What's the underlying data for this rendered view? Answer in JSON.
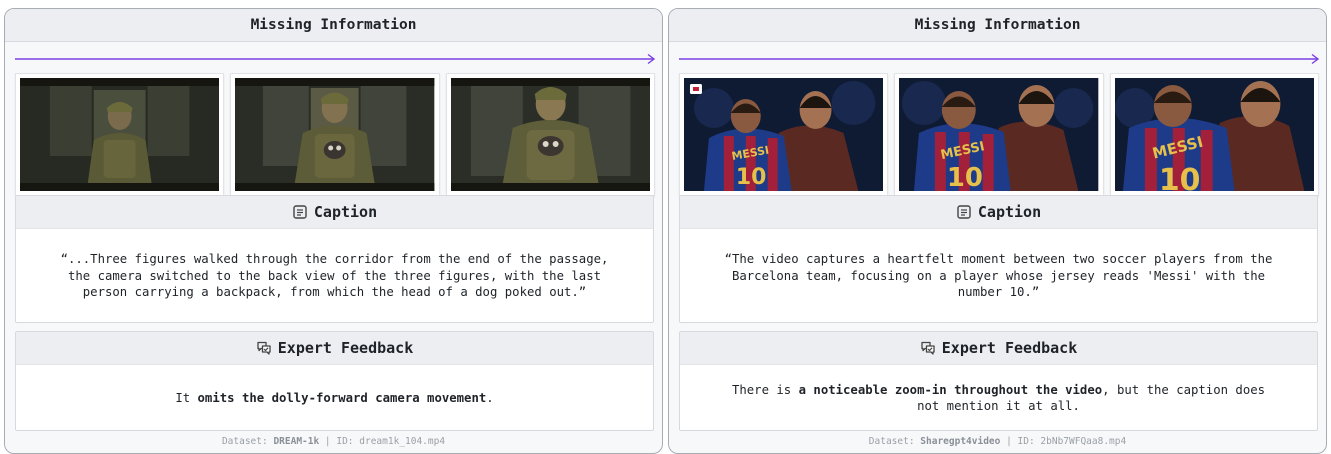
{
  "panels": [
    {
      "title": "Missing Information",
      "caption_label": "Caption",
      "caption_text": "“...Three figures walked through the corridor from the end of the passage, the camera switched to the back view of the three figures, with the last person carrying a backpack, from which the head of a dog poked out.”",
      "feedback_label": "Expert Feedback",
      "feedback_pre": "It ",
      "feedback_bold": "omits the dolly-forward camera movement",
      "feedback_post": ".",
      "footer_dataset_label": "Dataset: ",
      "footer_dataset": "DREAM-1k",
      "footer_sep": " | ID: ",
      "footer_id": "dream1k_104.mp4"
    },
    {
      "title": "Missing Information",
      "caption_label": "Caption",
      "caption_text": "“The video captures a heartfelt moment between two soccer players from the Barcelona team, focusing on a player whose jersey reads 'Messi' with the number 10.”",
      "feedback_label": "Expert Feedback",
      "feedback_pre": "There is ",
      "feedback_bold": "a noticeable zoom-in throughout the video",
      "feedback_post": ", but the caption does not mention it at all.",
      "footer_dataset_label": "Dataset: ",
      "footer_dataset": "Sharegpt4video",
      "footer_sep": " | ID: ",
      "footer_id": "2bNb7WFQaa8.mp4"
    }
  ],
  "frame_jersey_text": [
    "MESSI",
    "MESSI",
    "MESSI"
  ],
  "frame_jersey_number": [
    "10",
    "10",
    "10"
  ],
  "colors": {
    "arrow": "#7b3fe4",
    "header_bg": "#eceef1",
    "border": "#a8adb4"
  },
  "icons": {
    "caption": "document-icon",
    "feedback": "chat-bubbles-icon"
  }
}
